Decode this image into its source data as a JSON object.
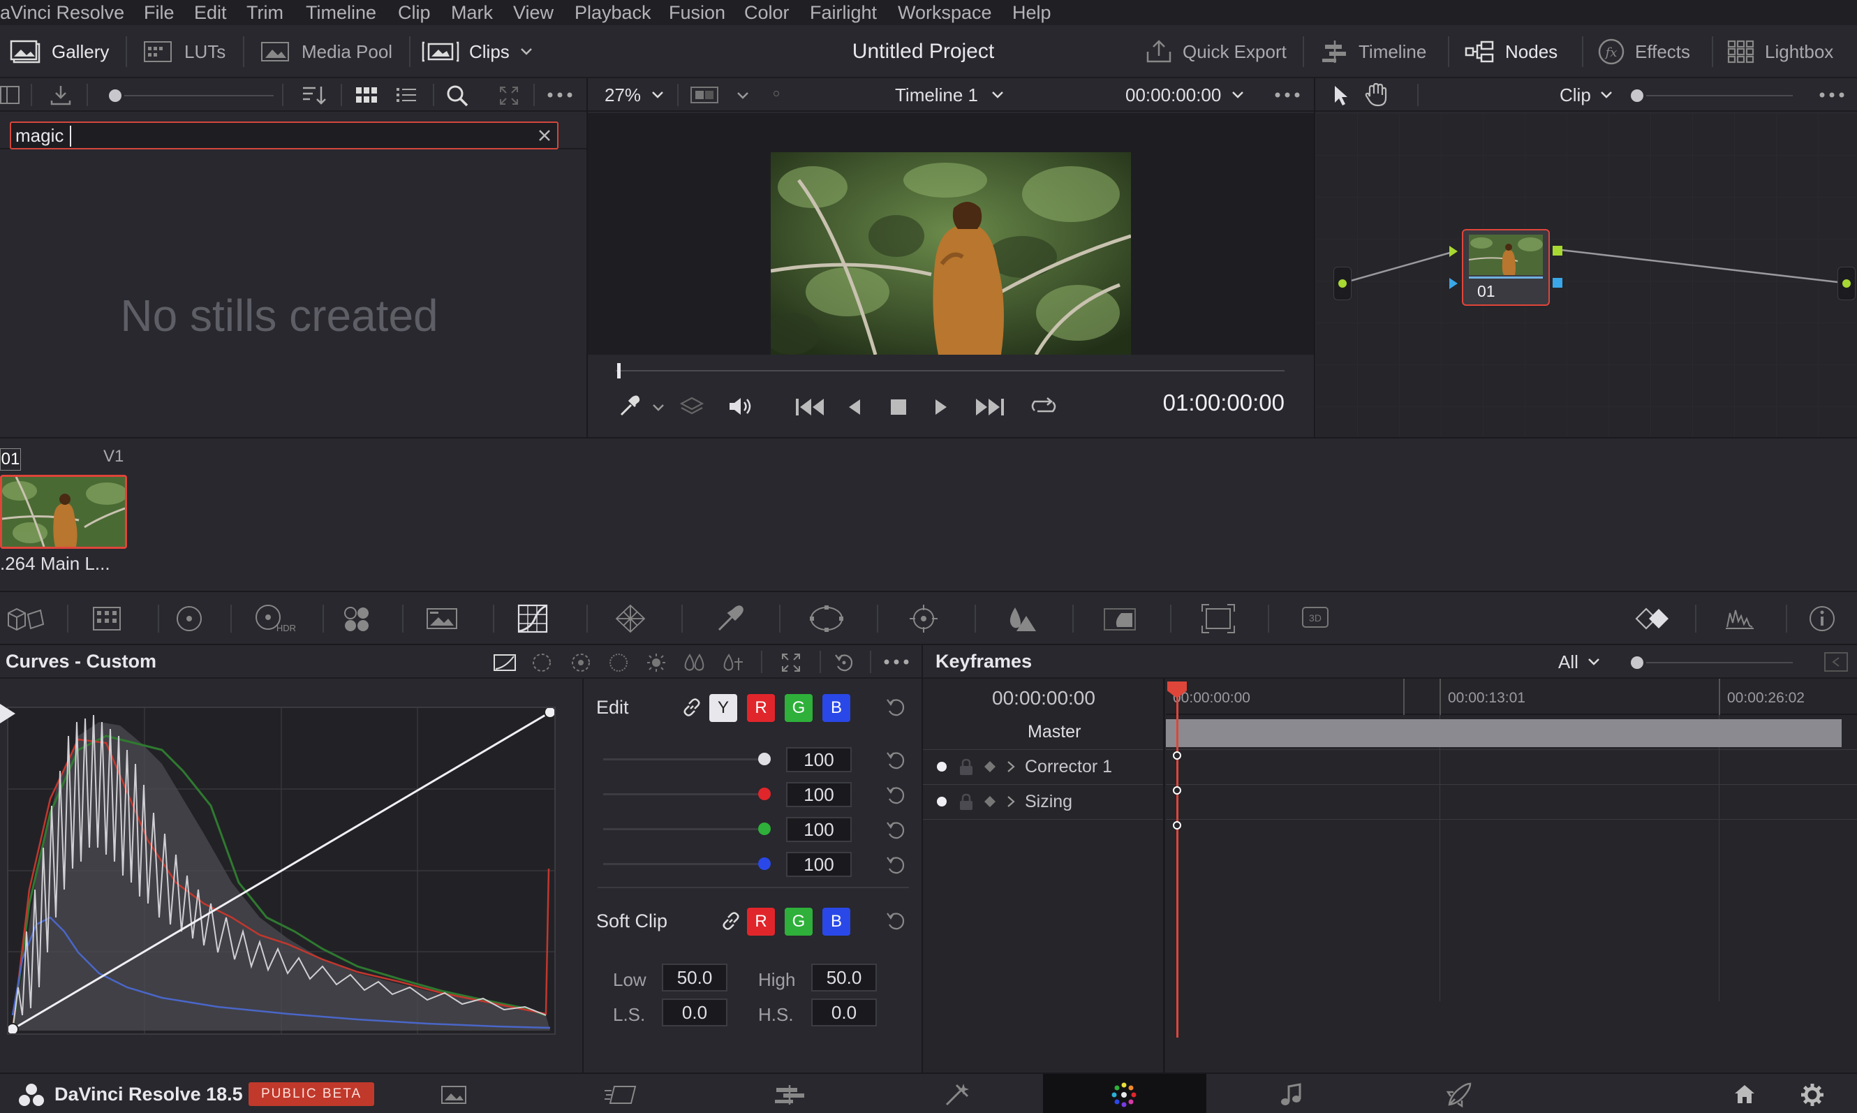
{
  "menu": {
    "app_name": "aVinci Resolve",
    "items": [
      "File",
      "Edit",
      "Trim",
      "Timeline",
      "Clip",
      "Mark",
      "View",
      "Playback",
      "Fusion",
      "Color",
      "Fairlight",
      "Workspace",
      "Help"
    ]
  },
  "toolbar": {
    "gallery": "Gallery",
    "luts": "LUTs",
    "media_pool": "Media Pool",
    "clips": "Clips",
    "project_title": "Untitled Project",
    "quick_export": "Quick Export",
    "timeline": "Timeline",
    "nodes": "Nodes",
    "effects": "Effects",
    "lightbox": "Lightbox"
  },
  "gallery": {
    "search_value": "magic",
    "empty_message": "No stills created"
  },
  "viewer": {
    "zoom": "27%",
    "timeline_name": "Timeline 1",
    "timecode_top": "00:00:00:00",
    "timecode": "01:00:00:00"
  },
  "nodes_panel": {
    "mode": "Clip",
    "node_label": "01"
  },
  "clip_strip": {
    "clip_number": "01",
    "track": "V1",
    "codec": ".264 Main L..."
  },
  "curves": {
    "title": "Curves - Custom",
    "edit_label": "Edit",
    "channels": [
      "Y",
      "R",
      "G",
      "B"
    ],
    "intensity": [
      "100",
      "100",
      "100",
      "100"
    ],
    "soft_clip_label": "Soft Clip",
    "soft_clip_channels": [
      "R",
      "G",
      "B"
    ],
    "low_label": "Low",
    "low_value": "50.0",
    "high_label": "High",
    "high_value": "50.0",
    "ls_label": "L.S.",
    "ls_value": "0.0",
    "hs_label": "H.S.",
    "hs_value": "0.0"
  },
  "keyframes": {
    "title": "Keyframes",
    "filter": "All",
    "current_time": "00:00:00:00",
    "ruler": [
      "00:00:00:00",
      "00:00:13:01",
      "00:00:26:02"
    ],
    "tracks": [
      "Master",
      "Corrector 1",
      "Sizing"
    ]
  },
  "footer": {
    "app_label": "DaVinci Resolve 18.5",
    "badge": "PUBLIC BETA"
  },
  "colors": {
    "accent": "#e0453a",
    "active_page": "#111114",
    "channel_r": "#e0262b",
    "channel_g": "#2eb03a",
    "channel_b": "#2a48e8"
  }
}
